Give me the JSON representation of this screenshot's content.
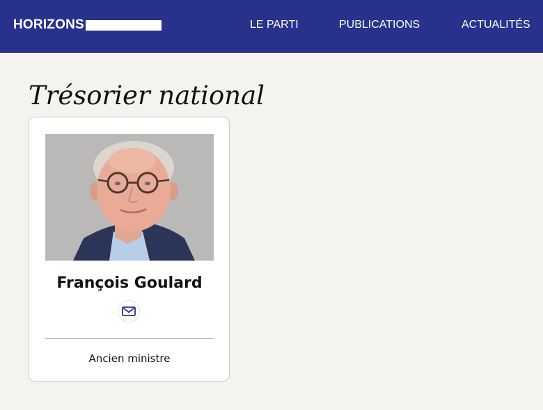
{
  "header": {
    "logo_text": "HORIZONS",
    "nav": [
      {
        "label": "LE PARTI"
      },
      {
        "label": "PUBLICATIONS"
      },
      {
        "label": "ACTUALITÉS"
      }
    ]
  },
  "section": {
    "title": "Trésorier national"
  },
  "card": {
    "name": "François Goulard",
    "role": "Ancien ministre",
    "contact_icon": "mail-icon"
  },
  "colors": {
    "header_bg": "#28328c",
    "page_bg": "#f4f4ef",
    "card_border": "#c9c9c9",
    "mail_icon": "#28328c"
  }
}
